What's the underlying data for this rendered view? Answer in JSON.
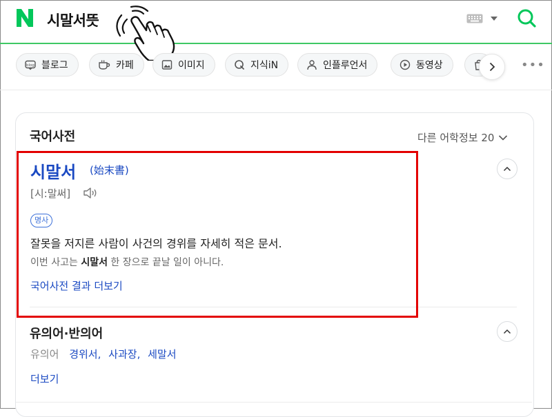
{
  "header": {
    "query": "시말서뜻",
    "brand_color": "#03c75a",
    "logo_icon": "naver-n-logo",
    "keyboard_icon": "keyboard-icon",
    "search_icon": "search-icon"
  },
  "tabs": [
    {
      "label": "블로그",
      "icon": "blog-icon"
    },
    {
      "label": "카페",
      "icon": "cafe-icon"
    },
    {
      "label": "이미지",
      "icon": "image-icon"
    },
    {
      "label": "지식iN",
      "icon": "q-icon"
    },
    {
      "label": "인플루언서",
      "icon": "person-icon"
    },
    {
      "label": "동영상",
      "icon": "play-icon"
    },
    {
      "label": "",
      "icon": "shopping-icon"
    }
  ],
  "dictionary": {
    "section_title": "국어사전",
    "more_info": "다른 어학정보 20",
    "headword": "시말서",
    "hanja": "(始末書)",
    "pronunciation": "[시:말써]",
    "part_of_speech": "명사",
    "definition": "잘못을 저지른 사람이 사건의 경위를 자세히 적은 문서.",
    "example_before": "이번 사고는 ",
    "example_bold": "시말서",
    "example_after": " 한 장으로 끝날 일이 아니다.",
    "more_link": "국어사전 결과 더보기"
  },
  "synonyms": {
    "title": "유의어·반의어",
    "label": "유의어",
    "words": [
      "경위서",
      "사과장",
      "세말서"
    ],
    "more_link": "더보기"
  },
  "colors": {
    "link_blue": "#1a49c2",
    "highlight_red": "#e30000",
    "header_underline": "#3ec864"
  }
}
